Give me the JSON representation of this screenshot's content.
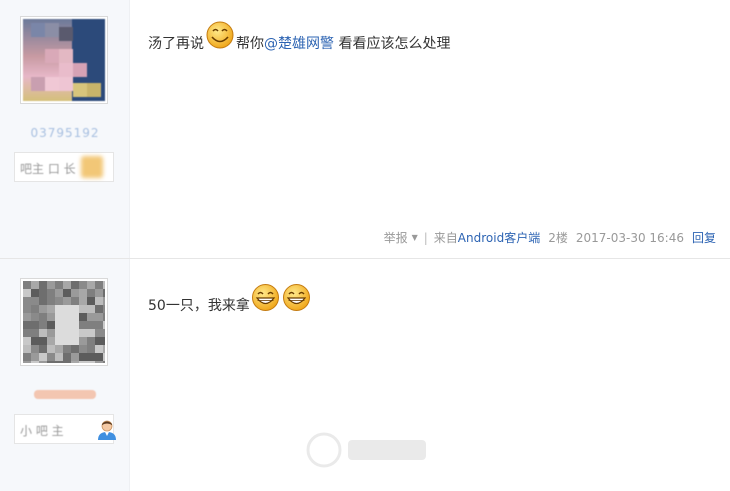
{
  "posts": [
    {
      "username": "03795192",
      "badge_text": "吧主 口 长",
      "content_before": "汤了再说",
      "content_after": "帮你",
      "mention": "@楚雄网警",
      "content_tail": " 看看应该怎么处理",
      "emoji": "smile-icon",
      "meta": {
        "report": "举报",
        "source_prefix": "来自",
        "source_link": "Android客户端",
        "floor": "2楼",
        "datetime": "2017-03-30 16:46",
        "reply": "回复"
      }
    },
    {
      "username": "",
      "badge_text": "小 吧 主",
      "content": "50一只，我来拿",
      "emoji": "grin-icon"
    }
  ],
  "colors": {
    "link": "#2d64b3",
    "sidebar_bg": "#f6f8fb",
    "meta_text": "#999999"
  }
}
